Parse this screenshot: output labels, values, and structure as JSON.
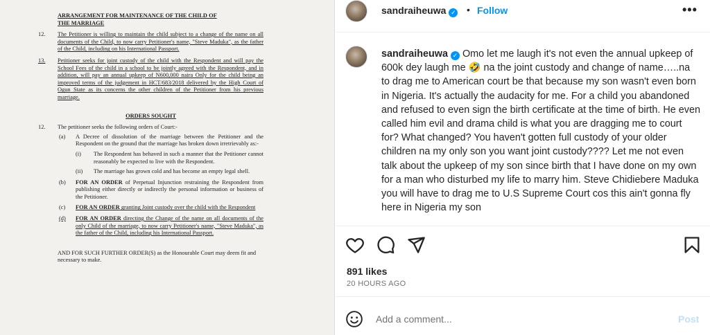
{
  "document": {
    "heading_line1": "ARRANGEMENT FOR MAINTENANCE OF THE CHILD OF",
    "heading_line2": "THE MARRIAGE",
    "p12_num": "12.",
    "p12_text": "The Petitioner is willing to maintain the child subject to a change of the name on all documents of the Child, to now carry Petitioner's name, \"Steve Maduka\", as the father of the Child, including on his International Passport.",
    "p13_num": "13.",
    "p13_text": "Petitioner seeks for joint custody of the child with the Respondent and will pay the School Fees of the child in a school to be jointly agreed with the Respondent, and in addition, will pay an annual upkeep of N600,000 naira Only for the child being an improved terms of the judgement in HCT/683/2018 delivered by the High Court of Ogun State as its concerns the other children of the Petitioner from his previous marriage.",
    "orders_heading": "ORDERS SOUGHT",
    "o12_num": "12.",
    "o12_text": "The petitioner seeks the following orders of Court:-",
    "a_label": "(a)",
    "a_text": "A Decree of dissolution of the marriage between the Petitioner and the Respondent on the ground that the marriage has broken down irretrievably as:-",
    "i_label": "(i)",
    "i_text": "The Respondent has behaved in such a manner that the Petitioner cannot reasonably be expected to live with the Respondent.",
    "ii_label": "(ii)",
    "ii_text": "The marriage has grown cold and has become an empty legal shell.",
    "b_label": "(b)",
    "b_bold": "FOR AN ORDER",
    "b_text": " of Perpetual Injunction restraining the Respondent from publishing either directly or indirectly the personal information or business of the Petitioner.",
    "c_label": "(c)",
    "c_bold": "FOR AN ORDER",
    "c_text": " granting Joint custody over the child with the Respondent",
    "d_label": "(d)",
    "d_bold": "FOR AN ORDER",
    "d_text": " directing the Change of the name on all documents of the only Child of the marriage, to now carry Petitioner's name, \"Steve Maduka\", as the father of the Child, including his International Passport.",
    "closing": "AND FOR SUCH FURTHER ORDER(S) as the Honourable Court may deem fit and necessary to make."
  },
  "header": {
    "username": "sandraiheuwa",
    "dot": "•",
    "follow_label": "Follow",
    "more_label": "•••"
  },
  "caption": {
    "username": "sandraiheuwa",
    "text_part1": "Omo let me laugh it's not even the annual upkeep of 600k dey laugh me ",
    "emoji": "🤣",
    "text_part2": " na the joint custody and change of name…..na to drag me to American court be that because my son wasn't even born in Nigeria. It's actually the audacity for me. For a child you abandoned and refused to even sign the birth certificate at the time of birth. He even called him evil and drama child is what you are dragging me to court for? What changed? You haven't gotten full custody of your older children na my only son you want joint custody???? Let me not even talk about the upkeep of my son since birth that I have done on my own for a man who disturbed my life to marry him. Steve Chidiebere Maduka you will have to drag me to U.S Supreme Court cos this ain't gonna fly here in Nigeria my son"
  },
  "stats": {
    "likes": "891 likes",
    "time": "20 HOURS AGO"
  },
  "comment": {
    "placeholder": "Add a comment...",
    "post_label": "Post"
  },
  "icons": {
    "like": "heart-icon",
    "comment": "comment-bubble-icon",
    "share": "paper-plane-icon",
    "save": "bookmark-icon",
    "emoji": "smiley-icon",
    "verified": "verified-badge-icon"
  },
  "colors": {
    "accent": "#0095f6",
    "post_disabled": "#c0dffd",
    "muted": "#737373"
  }
}
